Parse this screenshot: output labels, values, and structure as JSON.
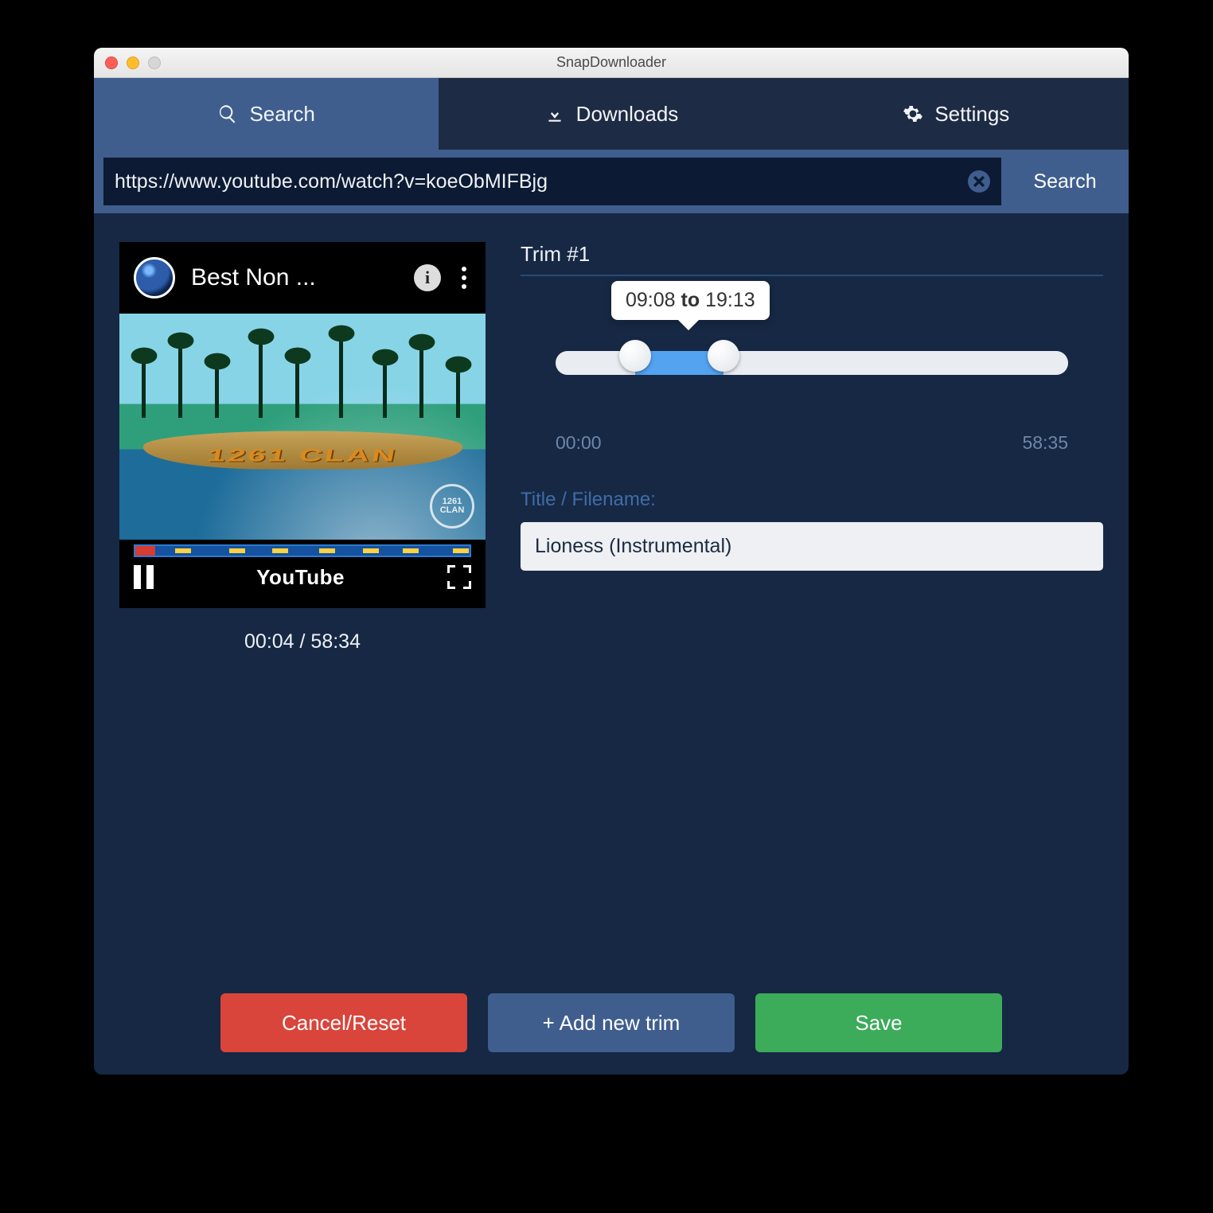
{
  "window": {
    "title": "SnapDownloader"
  },
  "tabs": {
    "search": "Search",
    "downloads": "Downloads",
    "settings": "Settings",
    "active": "search"
  },
  "url_bar": {
    "value": "https://www.youtube.com/watch?v=koeObMIFBjg",
    "search_label": "Search"
  },
  "preview": {
    "title": "Best Non ...",
    "sand_text": "1261 CLAN",
    "watermark": "1261 CLAN",
    "provider": "YouTube",
    "current": "00:04",
    "duration": "58:34",
    "time_line": "00:04 / 58:34",
    "markers_pct": [
      12,
      28,
      41,
      55,
      68,
      80,
      95
    ]
  },
  "trim": {
    "heading": "Trim #1",
    "from": "09:08",
    "to_word": "to",
    "to": "19:13",
    "start": "00:00",
    "end": "58:35",
    "from_pct": 15.6,
    "to_pct": 32.8
  },
  "filename": {
    "label": "Title / Filename:",
    "value": "Lioness (Instrumental)"
  },
  "buttons": {
    "cancel": "Cancel/Reset",
    "add": "+ Add new trim",
    "save": "Save"
  }
}
